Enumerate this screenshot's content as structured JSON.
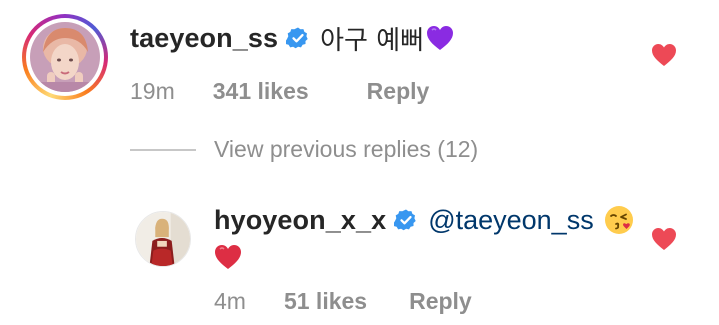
{
  "top_comment": {
    "username": "taeyeon_ss",
    "text": "아구 예뻐",
    "emoji": "purple-heart",
    "time": "19m",
    "likes": "341 likes",
    "reply_label": "Reply"
  },
  "view_previous_replies": "View previous replies (12)",
  "reply_comment": {
    "username": "hyoyeon_x_x",
    "mention": "@taeyeon_ss",
    "emoji": "face-blowing-kiss",
    "second_line_emoji": "red-heart",
    "time": "4m",
    "likes": "51 likes",
    "reply_label": "Reply"
  },
  "colors": {
    "verified_blue": "#3897f0",
    "like_heart": "#ed4956",
    "meta_gray": "#8e8e8e",
    "mention_blue": "#00376b"
  }
}
